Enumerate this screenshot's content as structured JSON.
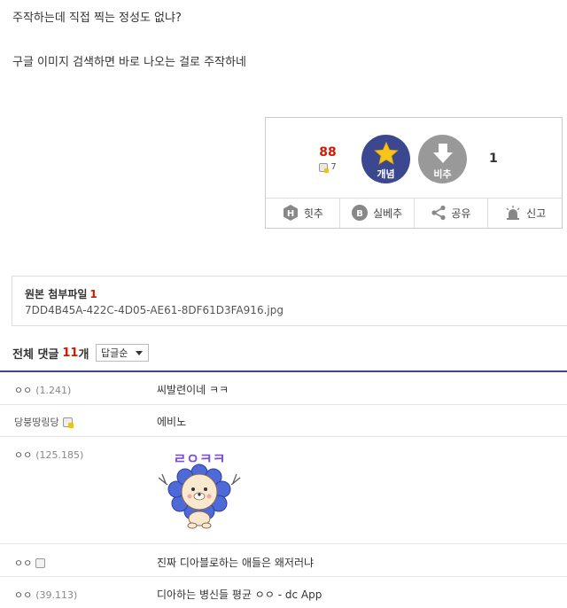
{
  "post": {
    "line1": "주작하는데 직접 찍는 정성도 없냐?",
    "line2": "구글 이미지 검색하면 바로 나오는 걸로 주작하네"
  },
  "recommend": {
    "up_count": "88",
    "fixed_count": "7",
    "up_label": "개념",
    "down_label": "비추",
    "down_count": "1",
    "actions": {
      "hit": "힛추",
      "silbe": "실베추",
      "share": "공유",
      "report": "신고"
    }
  },
  "attachment": {
    "title": "원본 첨부파일",
    "count": "1",
    "filename": "7DD4B45A-422C-4D05-AE61-8DF61D3FA916.jpg"
  },
  "comments": {
    "header": "전체 댓글",
    "count": "11",
    "count_unit": "개",
    "sort": "답글순",
    "items": [
      {
        "nick": "ㅇㅇ",
        "ip": "(1.241)",
        "text": "씨발련이네 ㅋㅋ"
      },
      {
        "nick": "당붕땅링당",
        "ip": "",
        "text": "에비노"
      },
      {
        "nick": "ㅇㅇ",
        "ip": "(125.185)",
        "text": ""
      },
      {
        "nick": "ㅇㅇ",
        "ip": "",
        "text": "진짜 디아블로하는 애들은 왜저러냐"
      },
      {
        "nick": "ㅇㅇ",
        "ip": "(39.113)",
        "text": "디아하는 병신들 평균 ㅇㅇ - dc App"
      }
    ],
    "sticker_text": "ㄹㅇㅋㅋ"
  },
  "colors": {
    "accent": "#3b4890",
    "count_red": "#d31900",
    "down_gray": "#999999"
  }
}
